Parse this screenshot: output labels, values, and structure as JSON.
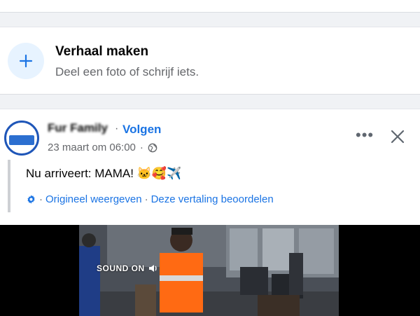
{
  "story": {
    "title": "Verhaal maken",
    "subtitle": "Deel een foto of schrijf iets.",
    "icon": "plus-icon"
  },
  "post": {
    "author": "Fur Family",
    "separator": "·",
    "follow_label": "Volgen",
    "timestamp": "23 maart om 06:00",
    "audience_icon": "globe-icon",
    "text": "Nu arriveert: MAMA! 🐱🥰✈️",
    "translate_icon": "gear-icon",
    "show_original": "Origineel weergeven",
    "rate_translation": "Deze vertaling beoordelen",
    "more_icon": "more-options-icon",
    "close_icon": "close-icon"
  },
  "video": {
    "sound_label": "SOUND ON"
  },
  "colors": {
    "link": "#1b74e4",
    "secondary_text": "#65676b",
    "background": "#f0f2f5"
  }
}
